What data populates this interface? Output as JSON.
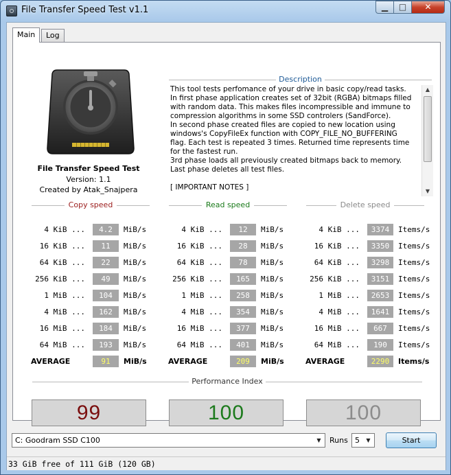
{
  "window": {
    "title": "File Transfer Speed Test v1.1"
  },
  "tabs": [
    {
      "label": "Main"
    },
    {
      "label": "Log"
    }
  ],
  "about": {
    "name": "File Transfer Speed Test",
    "version": "Version: 1.1",
    "author": "Created by Atak_Snajpera"
  },
  "description": {
    "header": "Description",
    "text": "This tool tests perfomance of your drive in basic copy/read tasks.\nIn first phase application creates set of 32bit (RGBA) bitmaps filled\nwith random data. This makes files incompressible and immune to\ncompression algorithms in some SSD controlers (SandForce).\nIn second phase created files are copied to new location using\nwindows's CopyFileEx function with COPY_FILE_NO_BUFFERING\nflag. Each test is repeated 3 times. Returned time represents time\nfor the fastest run.\n3rd phase loads all previously created bitmaps back to memory.\nLast phase deletes all test files.\n\n[ IMPORTANT NOTES ]"
  },
  "columns": {
    "copy": {
      "header": "Copy speed",
      "color": "#9b1c1c",
      "unit": "MiB/s",
      "rows": [
        {
          "size": "4 KiB ...",
          "value": "4.2"
        },
        {
          "size": "16 KiB ...",
          "value": "11"
        },
        {
          "size": "64 KiB ...",
          "value": "22"
        },
        {
          "size": "256 KiB ...",
          "value": "49"
        },
        {
          "size": "1 MiB ...",
          "value": "104"
        },
        {
          "size": "4 MiB ...",
          "value": "162"
        },
        {
          "size": "16 MiB ...",
          "value": "184"
        },
        {
          "size": "64 MiB ...",
          "value": "193"
        }
      ],
      "average_label": "AVERAGE",
      "average": "91"
    },
    "read": {
      "header": "Read speed",
      "color": "#1a7a1a",
      "unit": "MiB/s",
      "rows": [
        {
          "size": "4 KiB ...",
          "value": "12"
        },
        {
          "size": "16 KiB ...",
          "value": "28"
        },
        {
          "size": "64 KiB ...",
          "value": "78"
        },
        {
          "size": "256 KiB ...",
          "value": "165"
        },
        {
          "size": "1 MiB ...",
          "value": "258"
        },
        {
          "size": "4 MiB ...",
          "value": "354"
        },
        {
          "size": "16 MiB ...",
          "value": "377"
        },
        {
          "size": "64 MiB ...",
          "value": "401"
        }
      ],
      "average_label": "AVERAGE",
      "average": "209"
    },
    "delete": {
      "header": "Delete speed",
      "color": "#8a8a8a",
      "unit": "Items/s",
      "rows": [
        {
          "size": "4 KiB ...",
          "value": "3374"
        },
        {
          "size": "16 KiB ...",
          "value": "3350"
        },
        {
          "size": "64 KiB ...",
          "value": "3298"
        },
        {
          "size": "256 KiB ...",
          "value": "3151"
        },
        {
          "size": "1 MiB ...",
          "value": "2653"
        },
        {
          "size": "4 MiB ...",
          "value": "1641"
        },
        {
          "size": "16 MiB ...",
          "value": "667"
        },
        {
          "size": "64 MiB ...",
          "value": "190"
        }
      ],
      "average_label": "AVERAGE",
      "average": "2290"
    }
  },
  "performance": {
    "header": "Performance Index",
    "copy": {
      "value": "99",
      "color": "#7a0e0e"
    },
    "read": {
      "value": "100",
      "color": "#1c7a1c"
    },
    "delete": {
      "value": "100",
      "color": "#8c8c8c"
    }
  },
  "controls": {
    "drive": "C: Goodram SSD C100",
    "runs_label": "Runs",
    "runs": "5",
    "start_label": "Start"
  },
  "status": "33 GiB free of 111 GiB (120 GB)",
  "icons": {
    "logo": "stopwatch-drive-icon",
    "minimize": "minimize-icon",
    "maximize": "maximize-icon",
    "close": "close-icon",
    "dropdown": "chevron-down-icon"
  }
}
